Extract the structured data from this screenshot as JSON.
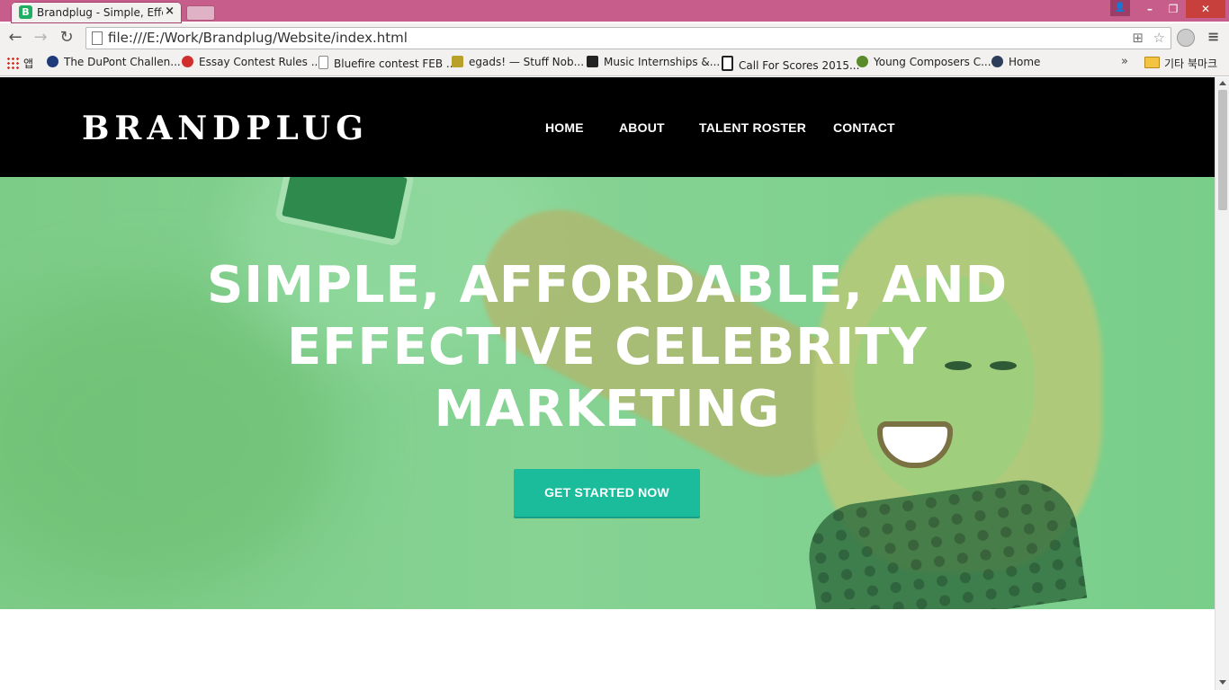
{
  "browser": {
    "tab_title": "Brandplug - Simple, Effect",
    "tab_favicon": "B",
    "tab_close": "×",
    "url": "file:///E:/Work/Brandplug/Website/index.html",
    "win_controls": {
      "minimize": "–",
      "maximize": "❐",
      "close": "✕",
      "user": "👤"
    },
    "nav": {
      "back": "←",
      "forward": "→",
      "reload": "↻",
      "menu": "≡"
    },
    "bookmarks": [
      {
        "label": "앱",
        "icon": "apps-icon"
      },
      {
        "label": "The DuPont Challen...",
        "icon": "dupont-icon",
        "color": "#1e3a7a"
      },
      {
        "label": "Essay Contest Rules ...",
        "icon": "flower-icon",
        "color": "#d22d2d"
      },
      {
        "label": "Bluefire contest FEB ...",
        "icon": "page-icon",
        "color": "#ffffff"
      },
      {
        "label": "egads! — Stuff Nob...",
        "icon": "egads-icon",
        "color": "#b8a12a"
      },
      {
        "label": "Music Internships &...",
        "icon": "chart-icon",
        "color": "#222222"
      },
      {
        "label": "Call For Scores 2015...",
        "icon": "b-icon",
        "color": "#222222"
      },
      {
        "label": "Young Composers C...",
        "icon": "yc-icon",
        "color": "#5a8a2a"
      },
      {
        "label": "Home",
        "icon": "globe-icon",
        "color": "#2d3e5a"
      }
    ],
    "bookmarks_more": "»",
    "other_bookmarks": "기타 북마크"
  },
  "site": {
    "logo": "BRANDPLUG",
    "nav": {
      "home": "HOME",
      "about": "ABOUT",
      "talent": "TALENT ROSTER",
      "contact": "CONTACT"
    },
    "hero": {
      "title": "SIMPLE, AFFORDABLE, AND EFFECTIVE CELEBRITY MARKETING",
      "cta": "GET STARTED NOW"
    }
  },
  "colors": {
    "header_bg": "#000000",
    "hero_overlay": "#7fd08e",
    "cta_bg": "#1abc9c",
    "titlebar": "#c75d8b"
  }
}
